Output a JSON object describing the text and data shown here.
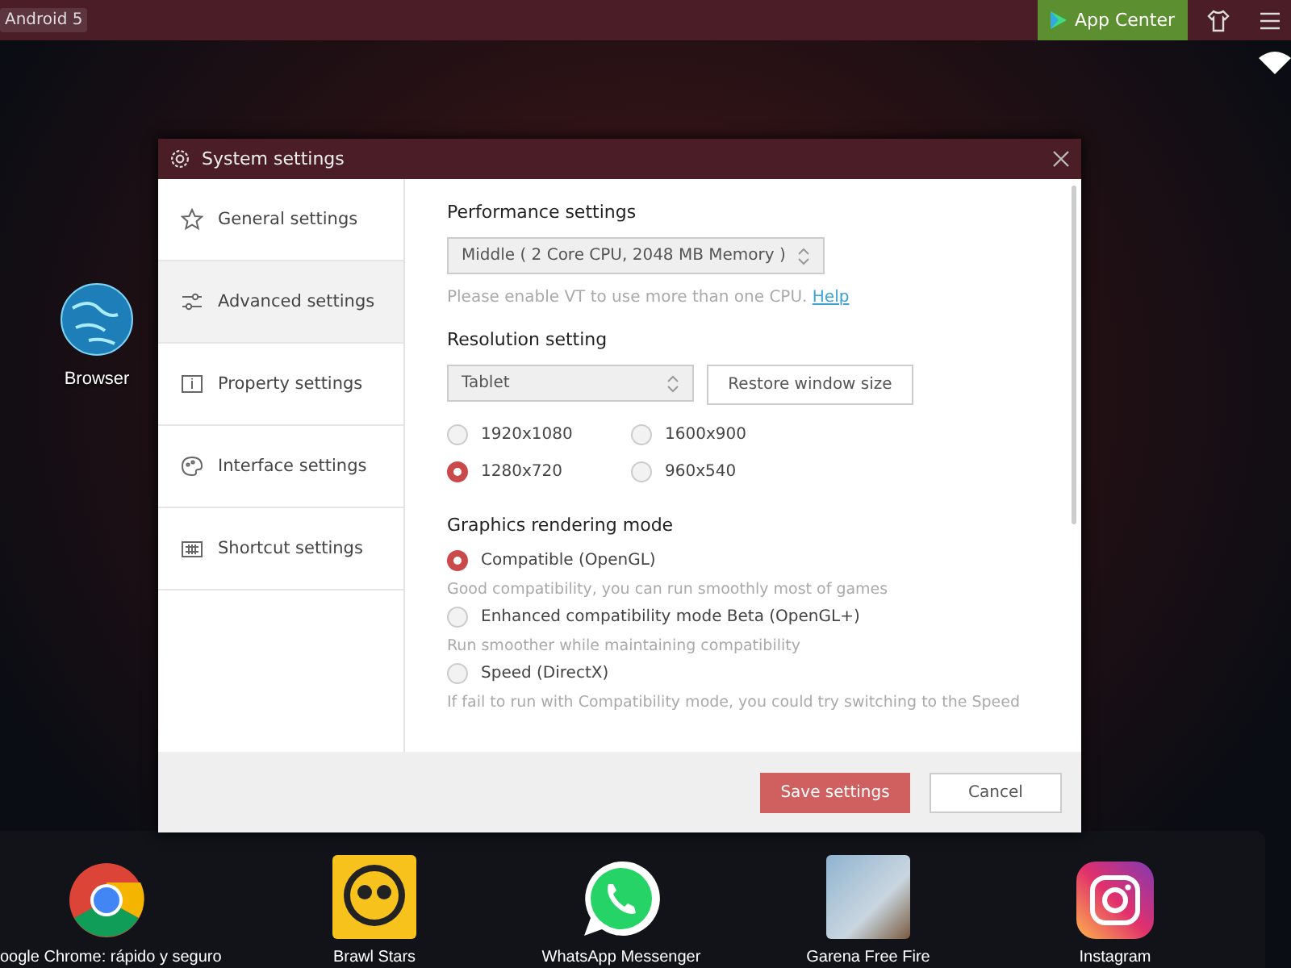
{
  "top_bar": {
    "badge": "Android 5",
    "app_center": "App Center"
  },
  "desktop_icons": [
    {
      "label": "Browser",
      "kind": "globe"
    }
  ],
  "dialog": {
    "title": "System settings",
    "nav": [
      {
        "label": "General settings",
        "kind": "star",
        "selected": false
      },
      {
        "label": "Advanced settings",
        "kind": "sliders",
        "selected": true
      },
      {
        "label": "Property settings",
        "kind": "info",
        "selected": false
      },
      {
        "label": "Interface settings",
        "kind": "palette",
        "selected": false
      },
      {
        "label": "Shortcut settings",
        "kind": "keyboard",
        "selected": false
      }
    ],
    "performance": {
      "heading": "Performance settings",
      "value": "Middle ( 2 Core CPU, 2048 MB Memory )",
      "hint": "Please enable VT to use more than one CPU.",
      "help_link": "Help"
    },
    "resolution": {
      "heading": "Resolution setting",
      "value": "Tablet",
      "restore_button": "Restore window size",
      "options": [
        {
          "label": "1920x1080",
          "selected": false
        },
        {
          "label": "1600x900",
          "selected": false
        },
        {
          "label": "1280x720",
          "selected": true
        },
        {
          "label": "960x540",
          "selected": false
        }
      ]
    },
    "graphics": {
      "heading": "Graphics rendering mode",
      "options": [
        {
          "label": "Compatible (OpenGL)",
          "description": "Good compatibility, you can run smoothly most of games",
          "selected": true
        },
        {
          "label": "Enhanced compatibility mode Beta (OpenGL+)",
          "description": "Run smoother while maintaining compatibility",
          "selected": false
        },
        {
          "label": "Speed (DirectX)",
          "description": "If fail to run with Compatibility mode, you could try switching to the Speed",
          "selected": false
        }
      ]
    },
    "save_button": "Save settings",
    "cancel_button": "Cancel"
  },
  "dock": [
    {
      "label": "oogle Chrome: rápido y seguro",
      "kind": "chrome"
    },
    {
      "label": "Brawl Stars",
      "kind": "brawl"
    },
    {
      "label": "WhatsApp Messenger",
      "kind": "whatsapp"
    },
    {
      "label": "Garena Free Fire",
      "kind": "photo"
    },
    {
      "label": "Instagram",
      "kind": "instagram"
    }
  ]
}
